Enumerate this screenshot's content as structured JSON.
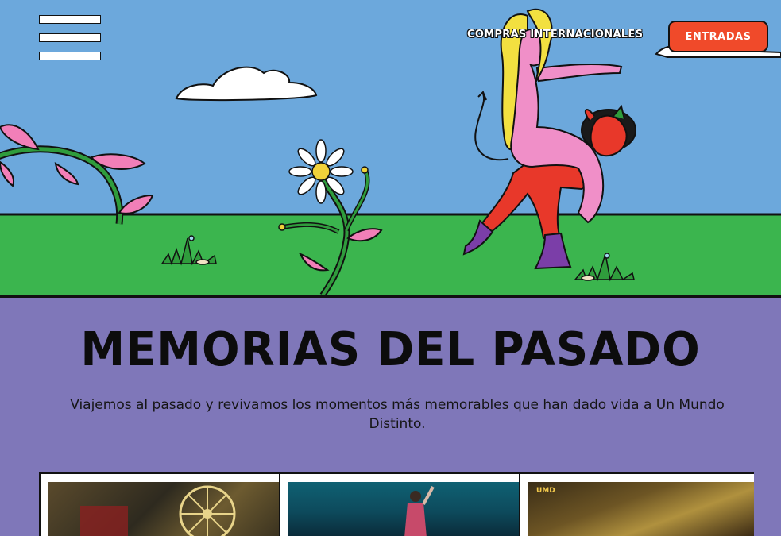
{
  "header": {
    "menu_label": "",
    "nav_link": "COMPRAS INTERNACIONALES",
    "cta_label": "ENTRADAS"
  },
  "section": {
    "title": "MEMORIAS DEL PASADO",
    "description": "Viajemos al pasado y revivamos los momentos más memorables que han dado vida a Un Mundo Distinto."
  },
  "cards": [
    {
      "alt": "Festival stage with ferris wheel"
    },
    {
      "alt": "Performer on stage with blue lights"
    },
    {
      "badge": "UMD",
      "alt": "Concert crowd with golden lights"
    }
  ],
  "colors": {
    "sky": "#6ca8dc",
    "grass": "#3bb54e",
    "section_bg": "#7f77b9",
    "cta": "#f04a2a"
  }
}
